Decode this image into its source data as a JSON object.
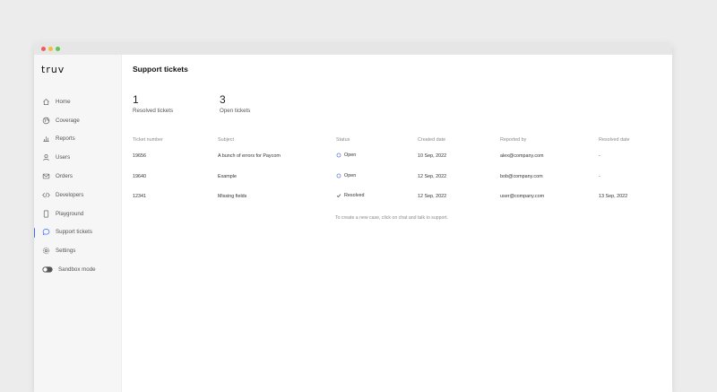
{
  "app": {
    "logo": "truv"
  },
  "sidebar": {
    "items": [
      {
        "label": "Home",
        "icon": "home-icon"
      },
      {
        "label": "Coverage",
        "icon": "globe-icon"
      },
      {
        "label": "Reports",
        "icon": "chart-icon"
      },
      {
        "label": "Users",
        "icon": "user-icon"
      },
      {
        "label": "Orders",
        "icon": "mail-icon"
      },
      {
        "label": "Developers",
        "icon": "code-icon"
      },
      {
        "label": "Playground",
        "icon": "device-icon"
      },
      {
        "label": "Support tickets",
        "icon": "chat-icon",
        "active": true
      },
      {
        "label": "Settings",
        "icon": "gear-icon"
      },
      {
        "label": "Sandbox mode",
        "icon": "toggle-icon"
      }
    ]
  },
  "main": {
    "title": "Support tickets",
    "stats": [
      {
        "value": "1",
        "label": "Resolved tickets"
      },
      {
        "value": "3",
        "label": "Open tickets"
      }
    ],
    "table": {
      "headers": [
        "Ticket number",
        "Subject",
        "Status",
        "Created date",
        "Reported by",
        "Resolved date"
      ],
      "rows": [
        {
          "number": "19656",
          "subject": "A bunch of errors for Paycom",
          "status": "Open",
          "created": "10 Sep, 2022",
          "reporter": "alex@company.com",
          "resolved": "-"
        },
        {
          "number": "19640",
          "subject": "Example",
          "status": "Open",
          "created": "12 Sep, 2022",
          "reporter": "bob@company.com",
          "resolved": "-"
        },
        {
          "number": "12341",
          "subject": "Missing fields",
          "status": "Resolved",
          "created": "12 Sep, 2022",
          "reporter": "user@company.com",
          "resolved": "13 Sep, 2022"
        }
      ]
    },
    "footer_note": "To create a new case, click on chat and talk to support."
  },
  "colors": {
    "accent": "#3b6ef5",
    "open_status": "#6b7fd7",
    "resolved_status": "#555555"
  }
}
